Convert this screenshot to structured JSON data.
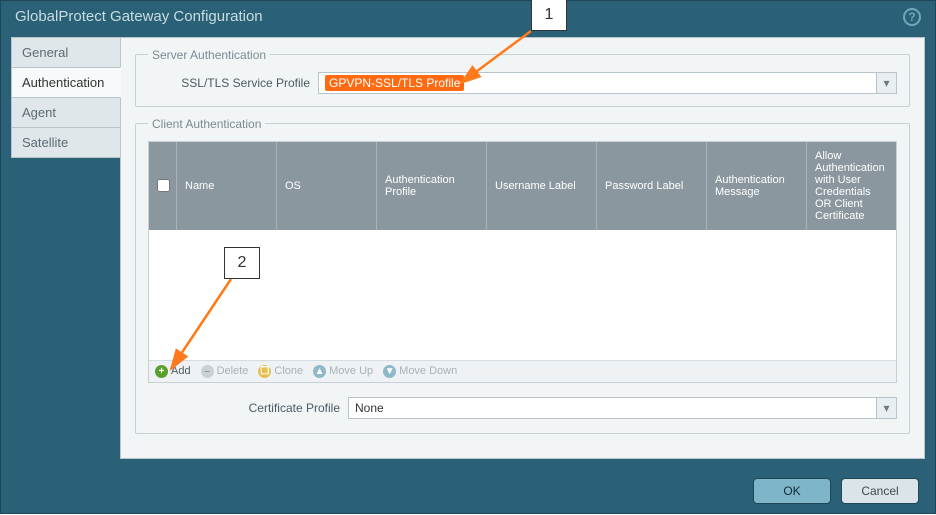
{
  "dialog": {
    "title": "GlobalProtect Gateway Configuration"
  },
  "tabs": {
    "items": [
      {
        "label": "General"
      },
      {
        "label": "Authentication"
      },
      {
        "label": "Agent"
      },
      {
        "label": "Satellite"
      }
    ],
    "active_index": 1
  },
  "server_auth": {
    "legend": "Server Authentication",
    "ssl_label": "SSL/TLS Service Profile",
    "ssl_value": "GPVPN-SSL/TLS Profile"
  },
  "client_auth": {
    "legend": "Client Authentication",
    "columns": {
      "name": "Name",
      "os": "OS",
      "auth_profile": "Authentication Profile",
      "username_label": "Username Label",
      "password_label": "Password Label",
      "auth_message": "Authentication Message",
      "allow": "Allow Authentication with User Credentials OR Client Certificate"
    },
    "toolbar": {
      "add": "Add",
      "delete": "Delete",
      "clone": "Clone",
      "move_up": "Move Up",
      "move_down": "Move Down"
    },
    "cert_profile_label": "Certificate Profile",
    "cert_profile_value": "None"
  },
  "footer": {
    "ok": "OK",
    "cancel": "Cancel"
  },
  "callouts": {
    "one": "1",
    "two": "2"
  }
}
